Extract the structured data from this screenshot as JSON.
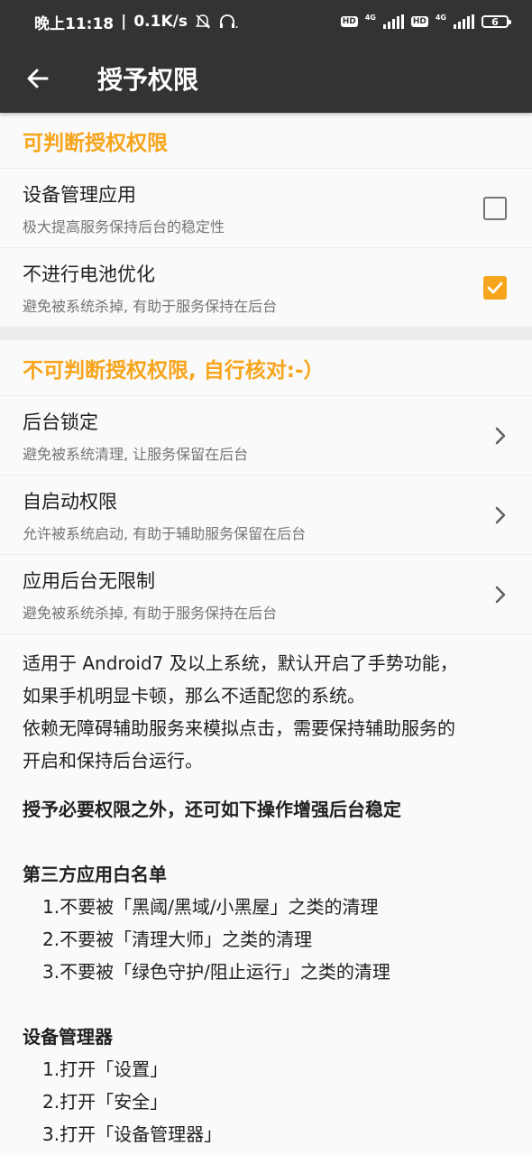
{
  "status": {
    "time": "晚上11:18",
    "speed": "0.1K/s",
    "hd1": "HD",
    "net1": "4G",
    "hd2": "HD",
    "net2": "4G",
    "battery": "6"
  },
  "toolbar": {
    "title": "授予权限"
  },
  "section1": {
    "header": "可判断授权权限",
    "items": [
      {
        "title": "设备管理应用",
        "subtitle": "极大提高服务保持后台的稳定性",
        "checked": false
      },
      {
        "title": "不进行电池优化",
        "subtitle": "避免被系统杀掉, 有助于服务保持在后台",
        "checked": true
      }
    ]
  },
  "section2": {
    "header": "不可判断授权权限, 自行核对:-）",
    "items": [
      {
        "title": "后台锁定",
        "subtitle": "避免被系统清理, 让服务保留在后台"
      },
      {
        "title": "自启动权限",
        "subtitle": "允许被系统启动, 有助于辅助服务保留在后台"
      },
      {
        "title": "应用后台无限制",
        "subtitle": "避免被系统杀掉, 有助于服务保持在后台"
      }
    ]
  },
  "info": {
    "line1": "适用于 Android7 及以上系统，默认开启了手势功能，",
    "line2": "如果手机明显卡顿，那么不适配您的系统。",
    "line3": "依赖无障碍辅助服务来模拟点击，需要保持辅助服务的",
    "line4": "开启和保持后台运行。",
    "heading": "授予必要权限之外，还可如下操作增强后台稳定",
    "whitelist_title": "第三方应用白名单",
    "whitelist": [
      "1.不要被「黑阈/黑域/小黑屋」之类的清理",
      "2.不要被「清理大师」之类的清理",
      "3.不要被「绿色守护/阻止运行」之类的清理"
    ],
    "device_admin_title": "设备管理器",
    "device_admin": [
      "1.打开「设置」",
      "2.打开「安全」",
      "3.打开「设备管理器」"
    ]
  },
  "colors": {
    "accent": "#f7a51c",
    "bar": "#333333"
  }
}
